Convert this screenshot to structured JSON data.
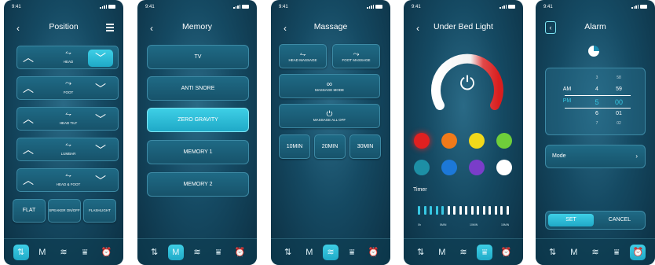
{
  "status": {
    "time": "9:41"
  },
  "nav_icons": [
    "position-icon",
    "memory-icon",
    "massage-icon",
    "light-icon",
    "alarm-icon"
  ],
  "nav_glyphs": [
    "⇅",
    "M",
    "≋",
    "⩸",
    "⏰"
  ],
  "screens": {
    "position": {
      "title": "Position",
      "rows": [
        {
          "label": "HEAD",
          "glyph": "⥊"
        },
        {
          "label": "FOOT",
          "glyph": "⤳"
        },
        {
          "label": "HEAD TILT",
          "glyph": "⥊"
        },
        {
          "label": "LUMBAR",
          "glyph": "⥊"
        },
        {
          "label": "HEAD & FOOT",
          "glyph": "⥊"
        }
      ],
      "bottom": {
        "flat": "FLAT",
        "speaker": "SPEAKER ON/OFF",
        "flashlight": "FLASHLIGHT"
      }
    },
    "memory": {
      "title": "Memory",
      "items": [
        "TV",
        "ANTI SNORE",
        "ZERO GRAVITY",
        "MEMORY 1",
        "MEMORY 2"
      ],
      "active_index": 2
    },
    "massage": {
      "title": "Massage",
      "head": "HEAD MASSAGE",
      "foot": "FOOT MASSAGE",
      "mode": "MASSAGE MODE",
      "all_off": "MASSAGE ALL OFF",
      "durations": [
        "10MIN",
        "20MIN",
        "30MIN"
      ]
    },
    "light": {
      "title": "Under Bed Light",
      "power_glyph": "⏻",
      "colors": [
        "#e02020",
        "#f07a1a",
        "#f2d81a",
        "#6fce3a",
        "#1d8fa5",
        "#1c78d8",
        "#7a3dc9",
        "#ffffff"
      ],
      "timer_label": "Timer",
      "timer_total_ticks": 16,
      "timer_active_ticks": 5,
      "timer_ticks_labels": [
        "0h",
        "5MIN",
        "10MIN",
        "15MIN"
      ]
    },
    "alarm": {
      "title": "Alarm",
      "ampm": [
        "AM",
        "PM"
      ],
      "hours": [
        "3",
        "4",
        "5",
        "6",
        "7"
      ],
      "minutes": [
        "58",
        "59",
        "00",
        "01",
        "02"
      ],
      "selected": {
        "hour": "5",
        "minute": "00",
        "ampm": "PM"
      },
      "mode_label": "Mode",
      "set_label": "SET",
      "cancel_label": "CANCEL"
    }
  }
}
